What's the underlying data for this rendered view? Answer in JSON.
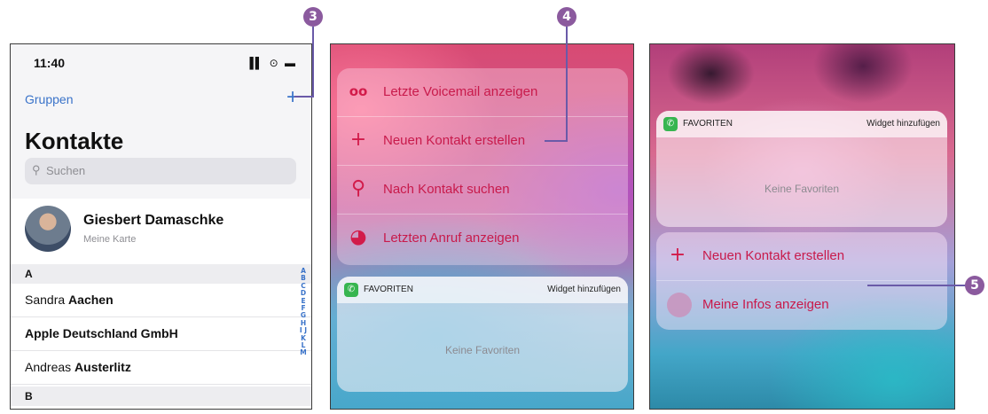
{
  "callouts": [
    "3",
    "4",
    "5"
  ],
  "panel1": {
    "time": "11:40",
    "status_icons": "▐▌ ⊙ ▬",
    "groups": "Gruppen",
    "add": "+",
    "title": "Kontakte",
    "search_placeholder": "Suchen",
    "my_card": {
      "name": "Giesbert Damaschke",
      "subtitle": "Meine Karte"
    },
    "section_a": "A",
    "rows": [
      {
        "first": "Sandra",
        "last": "Aachen"
      },
      {
        "first": "",
        "last": "Apple Deutschland GmbH"
      },
      {
        "first": "Andreas",
        "last": "Austerlitz"
      }
    ],
    "section_b": "B",
    "index": "A B C D E F G H I J K L M"
  },
  "panel2": {
    "menu": [
      {
        "icon": "voicemail-icon",
        "label": "Letzte Voicemail anzeigen"
      },
      {
        "icon": "plus-icon",
        "label": "Neuen Kontakt erstellen"
      },
      {
        "icon": "search-icon",
        "label": "Nach Kontakt suchen"
      },
      {
        "icon": "clock-icon",
        "label": "Letzten Anruf anzeigen"
      }
    ],
    "widget": {
      "title": "FAVORITEN",
      "add": "Widget hinzufügen",
      "empty": "Keine Favoriten"
    }
  },
  "panel3": {
    "widget": {
      "title": "FAVORITEN",
      "add": "Widget hinzufügen",
      "empty": "Keine Favoriten"
    },
    "menu": [
      {
        "icon": "plus-icon",
        "label": "Neuen Kontakt erstellen"
      },
      {
        "icon": "avatar-icon",
        "label": "Meine Infos anzeigen"
      }
    ]
  }
}
